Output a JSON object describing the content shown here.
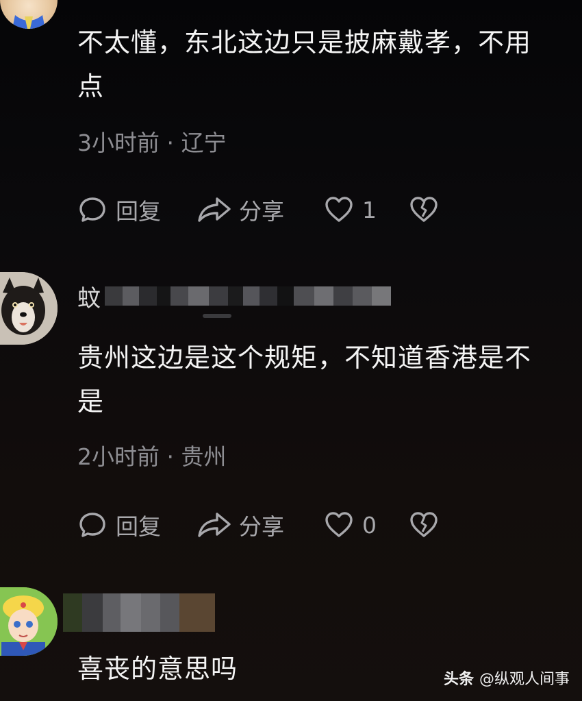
{
  "comments": [
    {
      "text": "不太懂，东北这边只是披麻戴孝，不用点",
      "meta": "3小时前 · 辽宁",
      "reply_label": "回复",
      "share_label": "分享",
      "like_count": "1"
    },
    {
      "username_visible": "蚊",
      "text": "贵州这边是这个规矩，不知道香港是不是",
      "meta": "2小时前 · 贵州",
      "reply_label": "回复",
      "share_label": "分享",
      "like_count": "0"
    },
    {
      "text": "喜丧的意思吗"
    }
  ],
  "watermark": {
    "logo": "头条",
    "handle": "@纵观人间事"
  },
  "icons": {
    "reply": "speech-bubble-icon",
    "share": "share-arrow-icon",
    "like": "heart-icon",
    "dislike": "broken-heart-icon"
  },
  "colors": {
    "background": "#0b0a0c",
    "text": "#f4f4f4",
    "muted": "#8e8e93",
    "action": "#a8a8ac"
  }
}
